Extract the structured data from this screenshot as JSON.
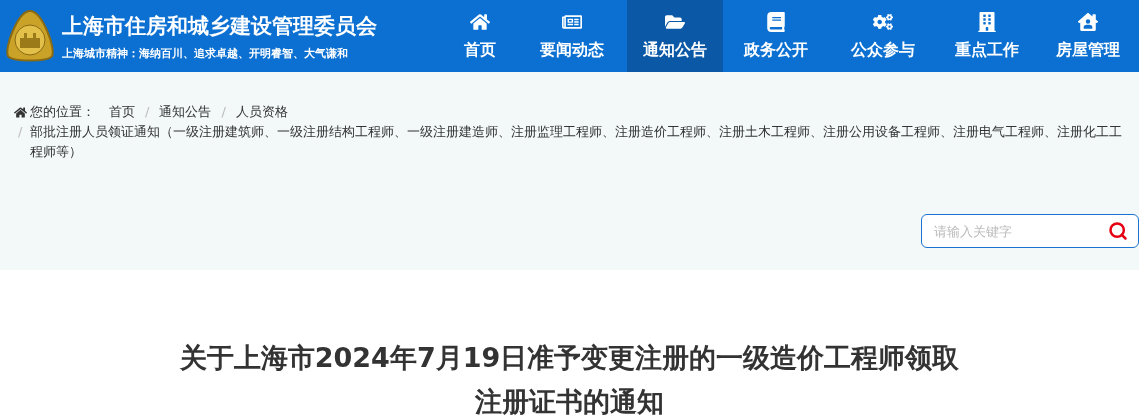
{
  "header": {
    "title": "上海市住房和城乡建设管理委员会",
    "slogan": "上海城市精神：海纳百川、追求卓越、开明睿智、大气谦和"
  },
  "nav": [
    {
      "label": "首页",
      "selected": false
    },
    {
      "label": "要闻动态",
      "selected": false
    },
    {
      "label": "通知公告",
      "selected": true
    },
    {
      "label": "政务公开",
      "selected": false
    },
    {
      "label": "公众参与",
      "selected": false
    },
    {
      "label": "重点工作",
      "selected": false
    },
    {
      "label": "房屋管理",
      "selected": false
    }
  ],
  "breadcrumb": {
    "label": "您的位置：",
    "separator": "/",
    "items": [
      "首页",
      "通知公告",
      "人员资格",
      "部批注册人员领证通知（一级注册建筑师、一级注册结构工程师、一级注册建造师、注册监理工程师、注册造价工程师、注册土木工程师、注册公用设备工程师、注册电气工程师、注册化工工程师等）"
    ]
  },
  "search": {
    "placeholder": "请输入关键字"
  },
  "article": {
    "title": "关于上海市2024年7月19日准予变更注册的一级造价工程师领取注册证书的通知"
  }
}
